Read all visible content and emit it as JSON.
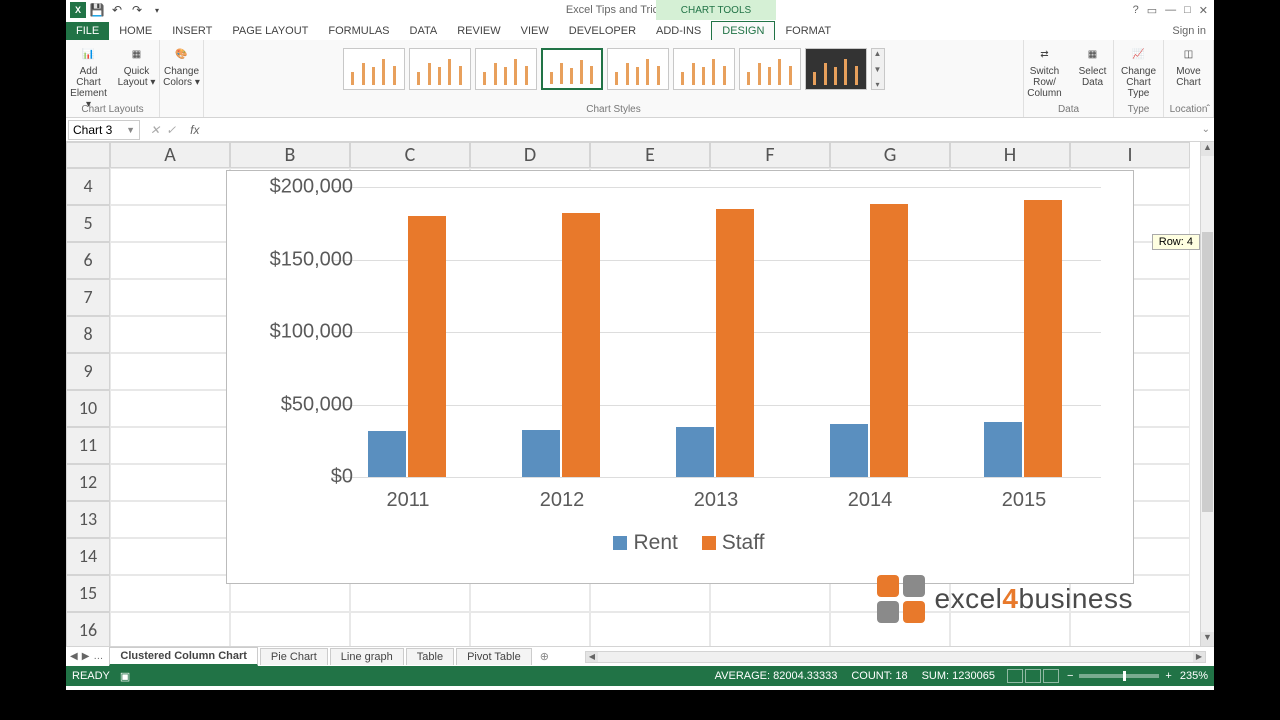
{
  "app_title": "Excel Tips and Tricks Final - Excel",
  "chart_tools_label": "CHART TOOLS",
  "signin": "Sign in",
  "tabs": [
    "FILE",
    "HOME",
    "INSERT",
    "PAGE LAYOUT",
    "FORMULAS",
    "DATA",
    "REVIEW",
    "VIEW",
    "DEVELOPER",
    "ADD-INS",
    "DESIGN",
    "FORMAT"
  ],
  "ribbon": {
    "groups": {
      "layouts": {
        "label": "Chart Layouts",
        "add_el": "Add Chart Element ▾",
        "quick": "Quick Layout ▾"
      },
      "colors": {
        "label": "",
        "change": "Change Colors ▾"
      },
      "styles": {
        "label": "Chart Styles"
      },
      "data": {
        "label": "Data",
        "switch": "Switch Row/ Column",
        "select": "Select Data"
      },
      "type": {
        "label": "Type",
        "change": "Change Chart Type"
      },
      "location": {
        "label": "Location",
        "move": "Move Chart"
      }
    }
  },
  "namebox": "Chart 3",
  "columns": [
    "A",
    "B",
    "C",
    "D",
    "E",
    "F",
    "G",
    "H",
    "I"
  ],
  "rows": [
    "4",
    "5",
    "6",
    "7",
    "8",
    "9",
    "10",
    "11",
    "12",
    "13",
    "14",
    "15",
    "16"
  ],
  "row_tooltip": "Row: 4",
  "sheet_tabs": [
    "Clustered Column Chart",
    "Pie Chart",
    "Line graph",
    "Table",
    "Pivot Table"
  ],
  "status": {
    "ready": "READY",
    "average": "AVERAGE: 82004.33333",
    "count": "COUNT: 18",
    "sum": "SUM: 1230065",
    "zoom": "235%"
  },
  "chart_data": {
    "type": "bar",
    "categories": [
      "2011",
      "2012",
      "2013",
      "2014",
      "2015"
    ],
    "series": [
      {
        "name": "Rent",
        "color": "#5a8fbf",
        "values": [
          35000,
          36000,
          38000,
          40000,
          42000
        ]
      },
      {
        "name": "Staff",
        "color": "#e8792b",
        "values": [
          198000,
          200000,
          203000,
          207000,
          210000
        ]
      }
    ],
    "ylabels": [
      "$0",
      "$50,000",
      "$100,000",
      "$150,000",
      "$200,000"
    ],
    "ylim": [
      0,
      220000
    ]
  },
  "logo": {
    "text_pre": "excel",
    "text_bold": "4",
    "text_post": "business"
  }
}
